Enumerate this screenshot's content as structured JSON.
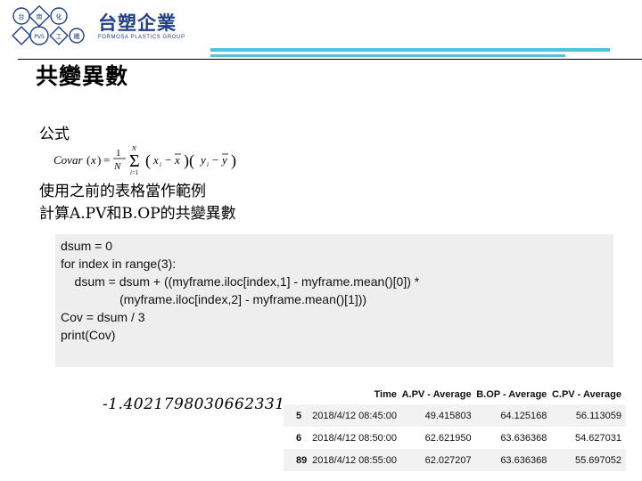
{
  "logo": {
    "name_cn": "台塑企業",
    "name_en": "FORMOSA PLASTICS GROUP",
    "emblem_text": "台塑關係企業標誌",
    "emblem_glyphs": [
      "台",
      "南",
      "化",
      "PVS",
      "工",
      "纖"
    ]
  },
  "title": "共變異數",
  "formula_label": "公式",
  "formula_image": "Covar(x) = (1/N) Σ_{i=1}^{N} (x_i − x̄)(y_i − ȳ)",
  "example_label": "使用之前的表格當作範例",
  "calc_label": "計算A.PV和B.OP的共變異數",
  "code_lines": [
    "dsum = 0",
    "for index in range(3):",
    "    dsum = dsum + ((myframe.iloc[index,1] - myframe.mean()[0]) *",
    "                 (myframe.iloc[index,2] - myframe.mean()[1]))",
    "Cov = dsum / 3",
    "print(Cov)"
  ],
  "result": "-1.4021798030662331",
  "dataframe": {
    "columns": [
      "",
      "Time",
      "A.PV - Average",
      "B.OP - Average",
      "C.PV - Average"
    ],
    "rows": [
      {
        "index": "5",
        "time": "2018/4/12 08:45:00",
        "a": "49.415803",
        "b": "64.125168",
        "c": "56.113059"
      },
      {
        "index": "6",
        "time": "2018/4/12 08:50:00",
        "a": "62.621950",
        "b": "63.636368",
        "c": "54.627031"
      },
      {
        "index": "89",
        "time": "2018/4/12 08:55:00",
        "a": "62.027207",
        "b": "63.636368",
        "c": "55.697052"
      }
    ]
  },
  "colors": {
    "brand_blue": "#1f3f86",
    "accent_cyan": "#4fc3dd",
    "code_bg": "#eeeeee"
  }
}
